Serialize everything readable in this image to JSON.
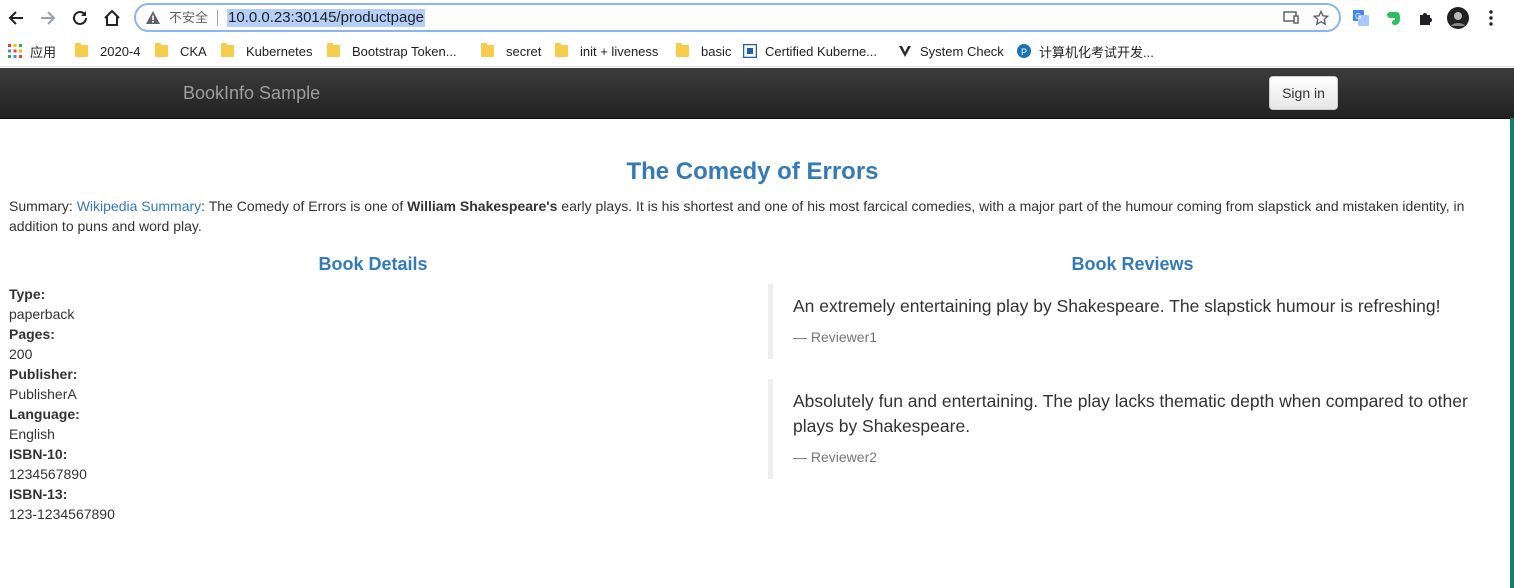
{
  "browser": {
    "insecure_label": "不安全",
    "url": "10.0.0.23:30145/productpage",
    "icons": [
      "back-icon",
      "forward-icon",
      "reload-icon",
      "home-icon",
      "warning-icon",
      "cast-icon",
      "star-icon",
      "translate-icon",
      "evernote-icon",
      "puzzle-icon",
      "profile-avatar",
      "menu-dots-icon"
    ]
  },
  "bookmarks": [
    {
      "label": "应用",
      "icon": "apps-grid-icon"
    },
    {
      "label": "2020-4",
      "icon": "folder-icon"
    },
    {
      "label": "CKA",
      "icon": "folder-icon"
    },
    {
      "label": "Kubernetes",
      "icon": "folder-icon"
    },
    {
      "label": "Bootstrap Token...",
      "icon": "folder-icon"
    },
    {
      "label": "secret",
      "icon": "folder-icon"
    },
    {
      "label": "init + liveness",
      "icon": "folder-icon"
    },
    {
      "label": "basic",
      "icon": "folder-icon"
    },
    {
      "label": "Certified Kuberne...",
      "icon": "site-icon"
    },
    {
      "label": "System Check",
      "icon": "site-icon"
    },
    {
      "label": "计算机化考试开发...",
      "icon": "site-icon"
    }
  ],
  "navbar": {
    "brand": "BookInfo Sample",
    "signin": "Sign in"
  },
  "book": {
    "title": "The Comedy of Errors",
    "summary_prefix": "Summary: ",
    "summary_link": "Wikipedia Summary",
    "summary_text1": ": The Comedy of Errors is one of ",
    "summary_bold": "William Shakespeare's",
    "summary_text2": " early plays. It is his shortest and one of his most farcical comedies, with a major part of the humour coming from slapstick and mistaken identity, in addition to puns and word play."
  },
  "details": {
    "heading": "Book Details",
    "items": [
      {
        "label": "Type:",
        "value": "paperback"
      },
      {
        "label": "Pages:",
        "value": "200"
      },
      {
        "label": "Publisher:",
        "value": "PublisherA"
      },
      {
        "label": "Language:",
        "value": "English"
      },
      {
        "label": "ISBN-10:",
        "value": "1234567890"
      },
      {
        "label": "ISBN-13:",
        "value": "123-1234567890"
      }
    ]
  },
  "reviews": {
    "heading": "Book Reviews",
    "items": [
      {
        "text": "An extremely entertaining play by Shakespeare. The slapstick humour is refreshing!",
        "reviewer": "Reviewer1"
      },
      {
        "text": "Absolutely fun and entertaining. The play lacks thematic depth when compared to other plays by Shakespeare.",
        "reviewer": "Reviewer2"
      }
    ]
  }
}
